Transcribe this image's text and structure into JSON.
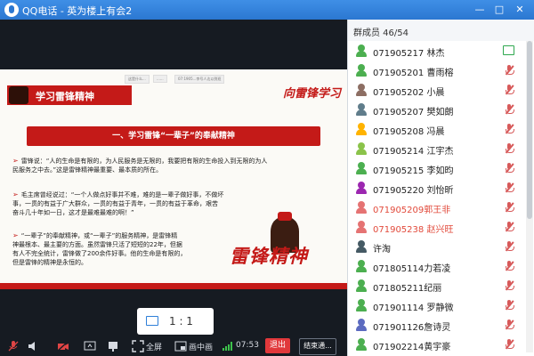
{
  "window": {
    "title": "QQ电话 - 英为楼上有会2",
    "minimize_glyph": "—",
    "maximize_glyph": "□",
    "close_glyph": "✕"
  },
  "slide": {
    "top_hints": [
      "这是什么...",
      "......",
      "07:1905...李号人达以到班"
    ],
    "banner_title": "学习雷锋精神",
    "calligraphy_top": "向雷锋学习",
    "section_title": "一、学习雷锋“一辈子”的奉献精神",
    "bullets": [
      "雷锋说：“人的生命是有限的，为人民服务是无限的，我要把有限的生命投入到无限的为人\n民服务之中去。”这是雷锋精神最重要、最本质的所在。",
      "毛主席曾经说过：“一个人做点好事并不难，难的是一辈子做好事，不做坏\n事，一贯的有益于广大群众，一贯的有益于青年，一贯的有益于革命，艰苦\n奋斗几十年如一日，这才是最难最难的啊！”",
      "“一辈子”的奉献精神，或“一辈子”的服务精神，是雷锋精\n神最根本、最主要的方面。虽然雷锋只活了短短的22年，但据\n有人不完全统计，雷锋做了200余件好事。他的生命是有限的，\n但是雷锋的精神是永恒的。"
    ],
    "calligraphy_big": "雷锋精神"
  },
  "zoom": {
    "ratio_label": "1 : 1",
    "icon": "screen-icon"
  },
  "toolbar": {
    "fullscreen_label": "全屏",
    "pip_label": "画中画",
    "timer": "07:53",
    "exit_label": "退出",
    "end_label": "结束通...",
    "accent_red": "#e1383b"
  },
  "members": {
    "header": "群成员 46/54",
    "list": [
      {
        "name": "071905217 林杰",
        "highlight": false,
        "status": "share",
        "avatar": "#4caf50"
      },
      {
        "name": "071905201 曹雨榕",
        "highlight": false,
        "status": "muted",
        "avatar": "#4caf50"
      },
      {
        "name": "071905202 小晨",
        "highlight": false,
        "status": "muted",
        "avatar": "#8d6e63"
      },
      {
        "name": "071905207 樊如朗",
        "highlight": false,
        "status": "muted",
        "avatar": "#607d8b"
      },
      {
        "name": "071905208 冯晨",
        "highlight": false,
        "status": "muted",
        "avatar": "#ffb300"
      },
      {
        "name": "071905214 江宇杰",
        "highlight": false,
        "status": "muted",
        "avatar": "#8bc34a"
      },
      {
        "name": "071905215 李如昀",
        "highlight": false,
        "status": "muted",
        "avatar": "#4caf50"
      },
      {
        "name": "071905220 刘怡昕",
        "highlight": false,
        "status": "muted",
        "avatar": "#9c27b0"
      },
      {
        "name": "071905209郭王非",
        "highlight": true,
        "status": "muted",
        "avatar": "#e57373"
      },
      {
        "name": "071905238 赵兴旺",
        "highlight": true,
        "status": "muted",
        "avatar": "#e57373"
      },
      {
        "name": "许淘",
        "highlight": false,
        "status": "muted",
        "avatar": "#455a64"
      },
      {
        "name": "071805114力若凌",
        "highlight": false,
        "status": "muted",
        "avatar": "#4caf50"
      },
      {
        "name": "071805211纪丽",
        "highlight": false,
        "status": "muted",
        "avatar": "#4caf50"
      },
      {
        "name": "071901114 罗静微",
        "highlight": false,
        "status": "muted",
        "avatar": "#4caf50"
      },
      {
        "name": "071901126詹诗灵",
        "highlight": false,
        "status": "muted",
        "avatar": "#5c6bc0"
      },
      {
        "name": "071902214黄宇豪",
        "highlight": false,
        "status": "muted",
        "avatar": "#4caf50"
      }
    ]
  }
}
